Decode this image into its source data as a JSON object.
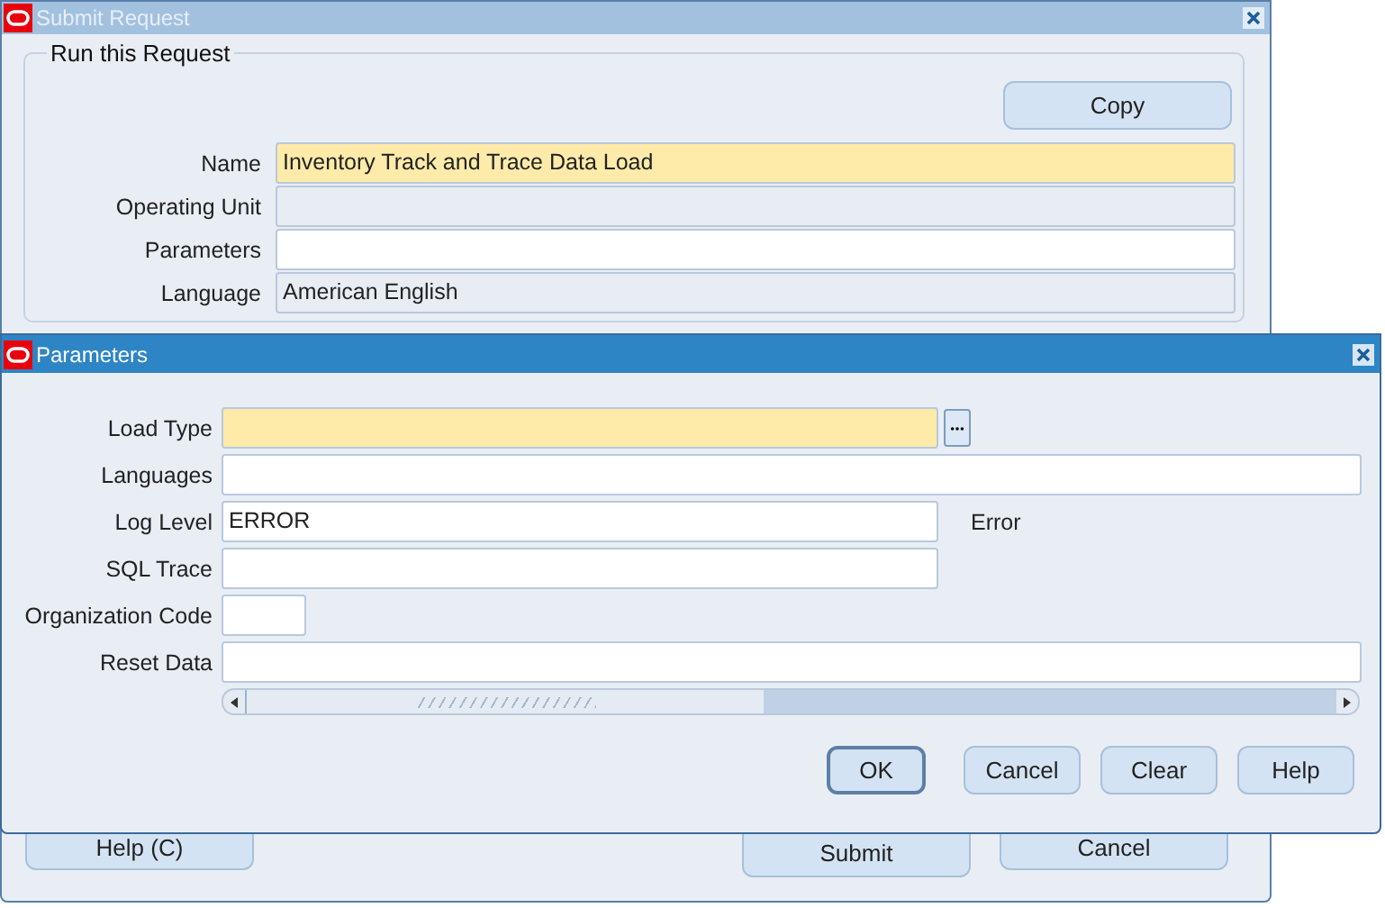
{
  "background_window": {
    "title": "Submit Request",
    "active": false,
    "group_title": "Run this Request",
    "copy_button": "Copy",
    "fields": [
      {
        "label": "Name",
        "value": "Inventory Track and Trace Data Load",
        "kind": "required"
      },
      {
        "label": "Operating Unit",
        "kind": "readonly"
      },
      {
        "label": "Parameters",
        "kind": "editable"
      },
      {
        "label": "Language",
        "value": "American English",
        "kind": "readonly"
      }
    ],
    "buttons": [
      {
        "label": "Help (C)",
        "kind": "left"
      },
      {
        "label": "Submit",
        "kind": "tall"
      },
      {
        "label": "Cancel",
        "kind": "right"
      }
    ]
  },
  "dialog": {
    "title": "Parameters",
    "active": true,
    "fields": [
      {
        "label": "Load Type",
        "kind": "required",
        "lov": true
      },
      {
        "label": "Languages",
        "kind": "wide"
      },
      {
        "label": "Log Level",
        "value": "ERROR",
        "kind": "editable",
        "note": "Error"
      },
      {
        "label": "SQL Trace",
        "kind": "editable"
      },
      {
        "label": "Organization Code",
        "kind": "short"
      },
      {
        "label": "Reset Data",
        "kind": "wide"
      }
    ],
    "buttons": [
      {
        "label": "OK",
        "default": true
      },
      {
        "label": "Cancel",
        "default": false
      },
      {
        "label": "Clear",
        "default": false
      },
      {
        "label": "Help",
        "default": false
      }
    ]
  }
}
